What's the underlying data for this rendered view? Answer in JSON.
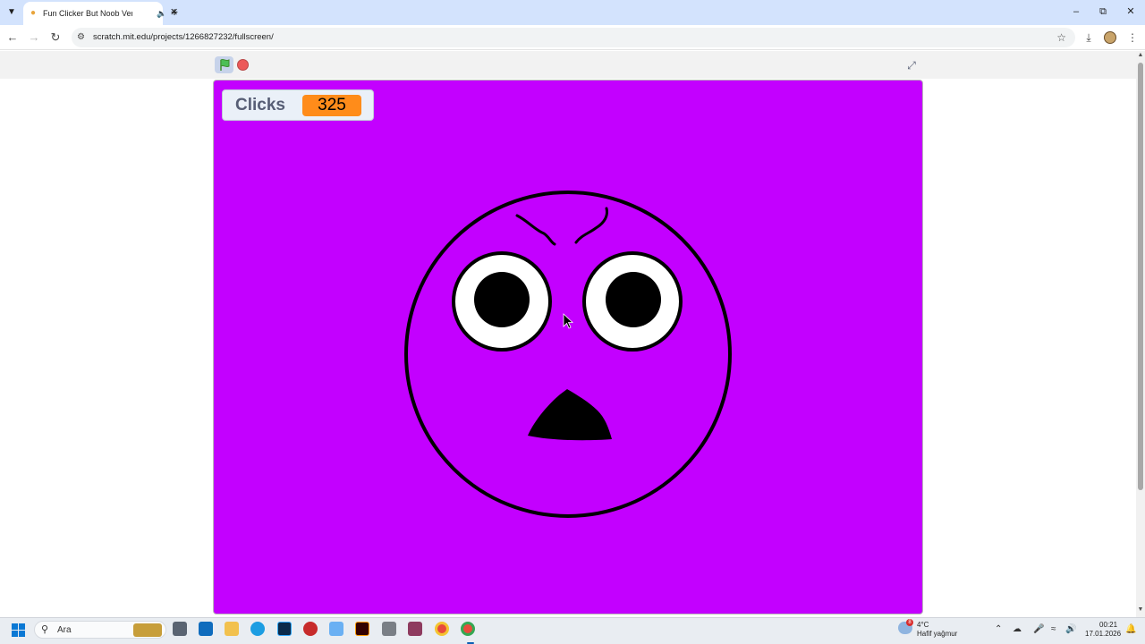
{
  "browser": {
    "tab_title": "Fun Clicker But Noob Versi",
    "url": "scratch.mit.edu/projects/1266827232/fullscreen/",
    "icons": {
      "tab_list": "chevron-down-icon",
      "audio": "speaker-icon",
      "close_tab": "close-icon",
      "new_tab": "plus-icon",
      "back": "arrow-left-icon",
      "forward": "arrow-right-icon",
      "reload": "reload-icon",
      "site_info": "tune-icon",
      "bookmark": "star-icon",
      "downloads": "download-icon",
      "menu": "kebab-menu-icon",
      "minimize": "minimize-icon",
      "restore": "restore-icon",
      "close_window": "close-icon"
    }
  },
  "scratch": {
    "monitor_label": "Clicks",
    "monitor_value": "325",
    "stage_color": "#c300ff",
    "monitor_value_color": "#ff8c1a",
    "icons": {
      "green_flag": "green-flag-icon",
      "stop": "stop-icon",
      "exit_fullscreen": "exit-fullscreen-icon"
    }
  },
  "taskbar": {
    "search_placeholder": "Ara",
    "weather_temp": "4°C",
    "weather_desc": "Hafif yağmur",
    "weather_badge": "8",
    "time": "00:21",
    "date": "17.01.2026",
    "apps": [
      "task-view-icon",
      "outlook-icon",
      "file-explorer-icon",
      "edge-icon",
      "photoshop-icon",
      "app-red-icon",
      "copilot-icon",
      "illustrator-icon",
      "app-gray-icon",
      "archive-icon",
      "chrome-icon",
      "chrome-active-icon"
    ]
  }
}
